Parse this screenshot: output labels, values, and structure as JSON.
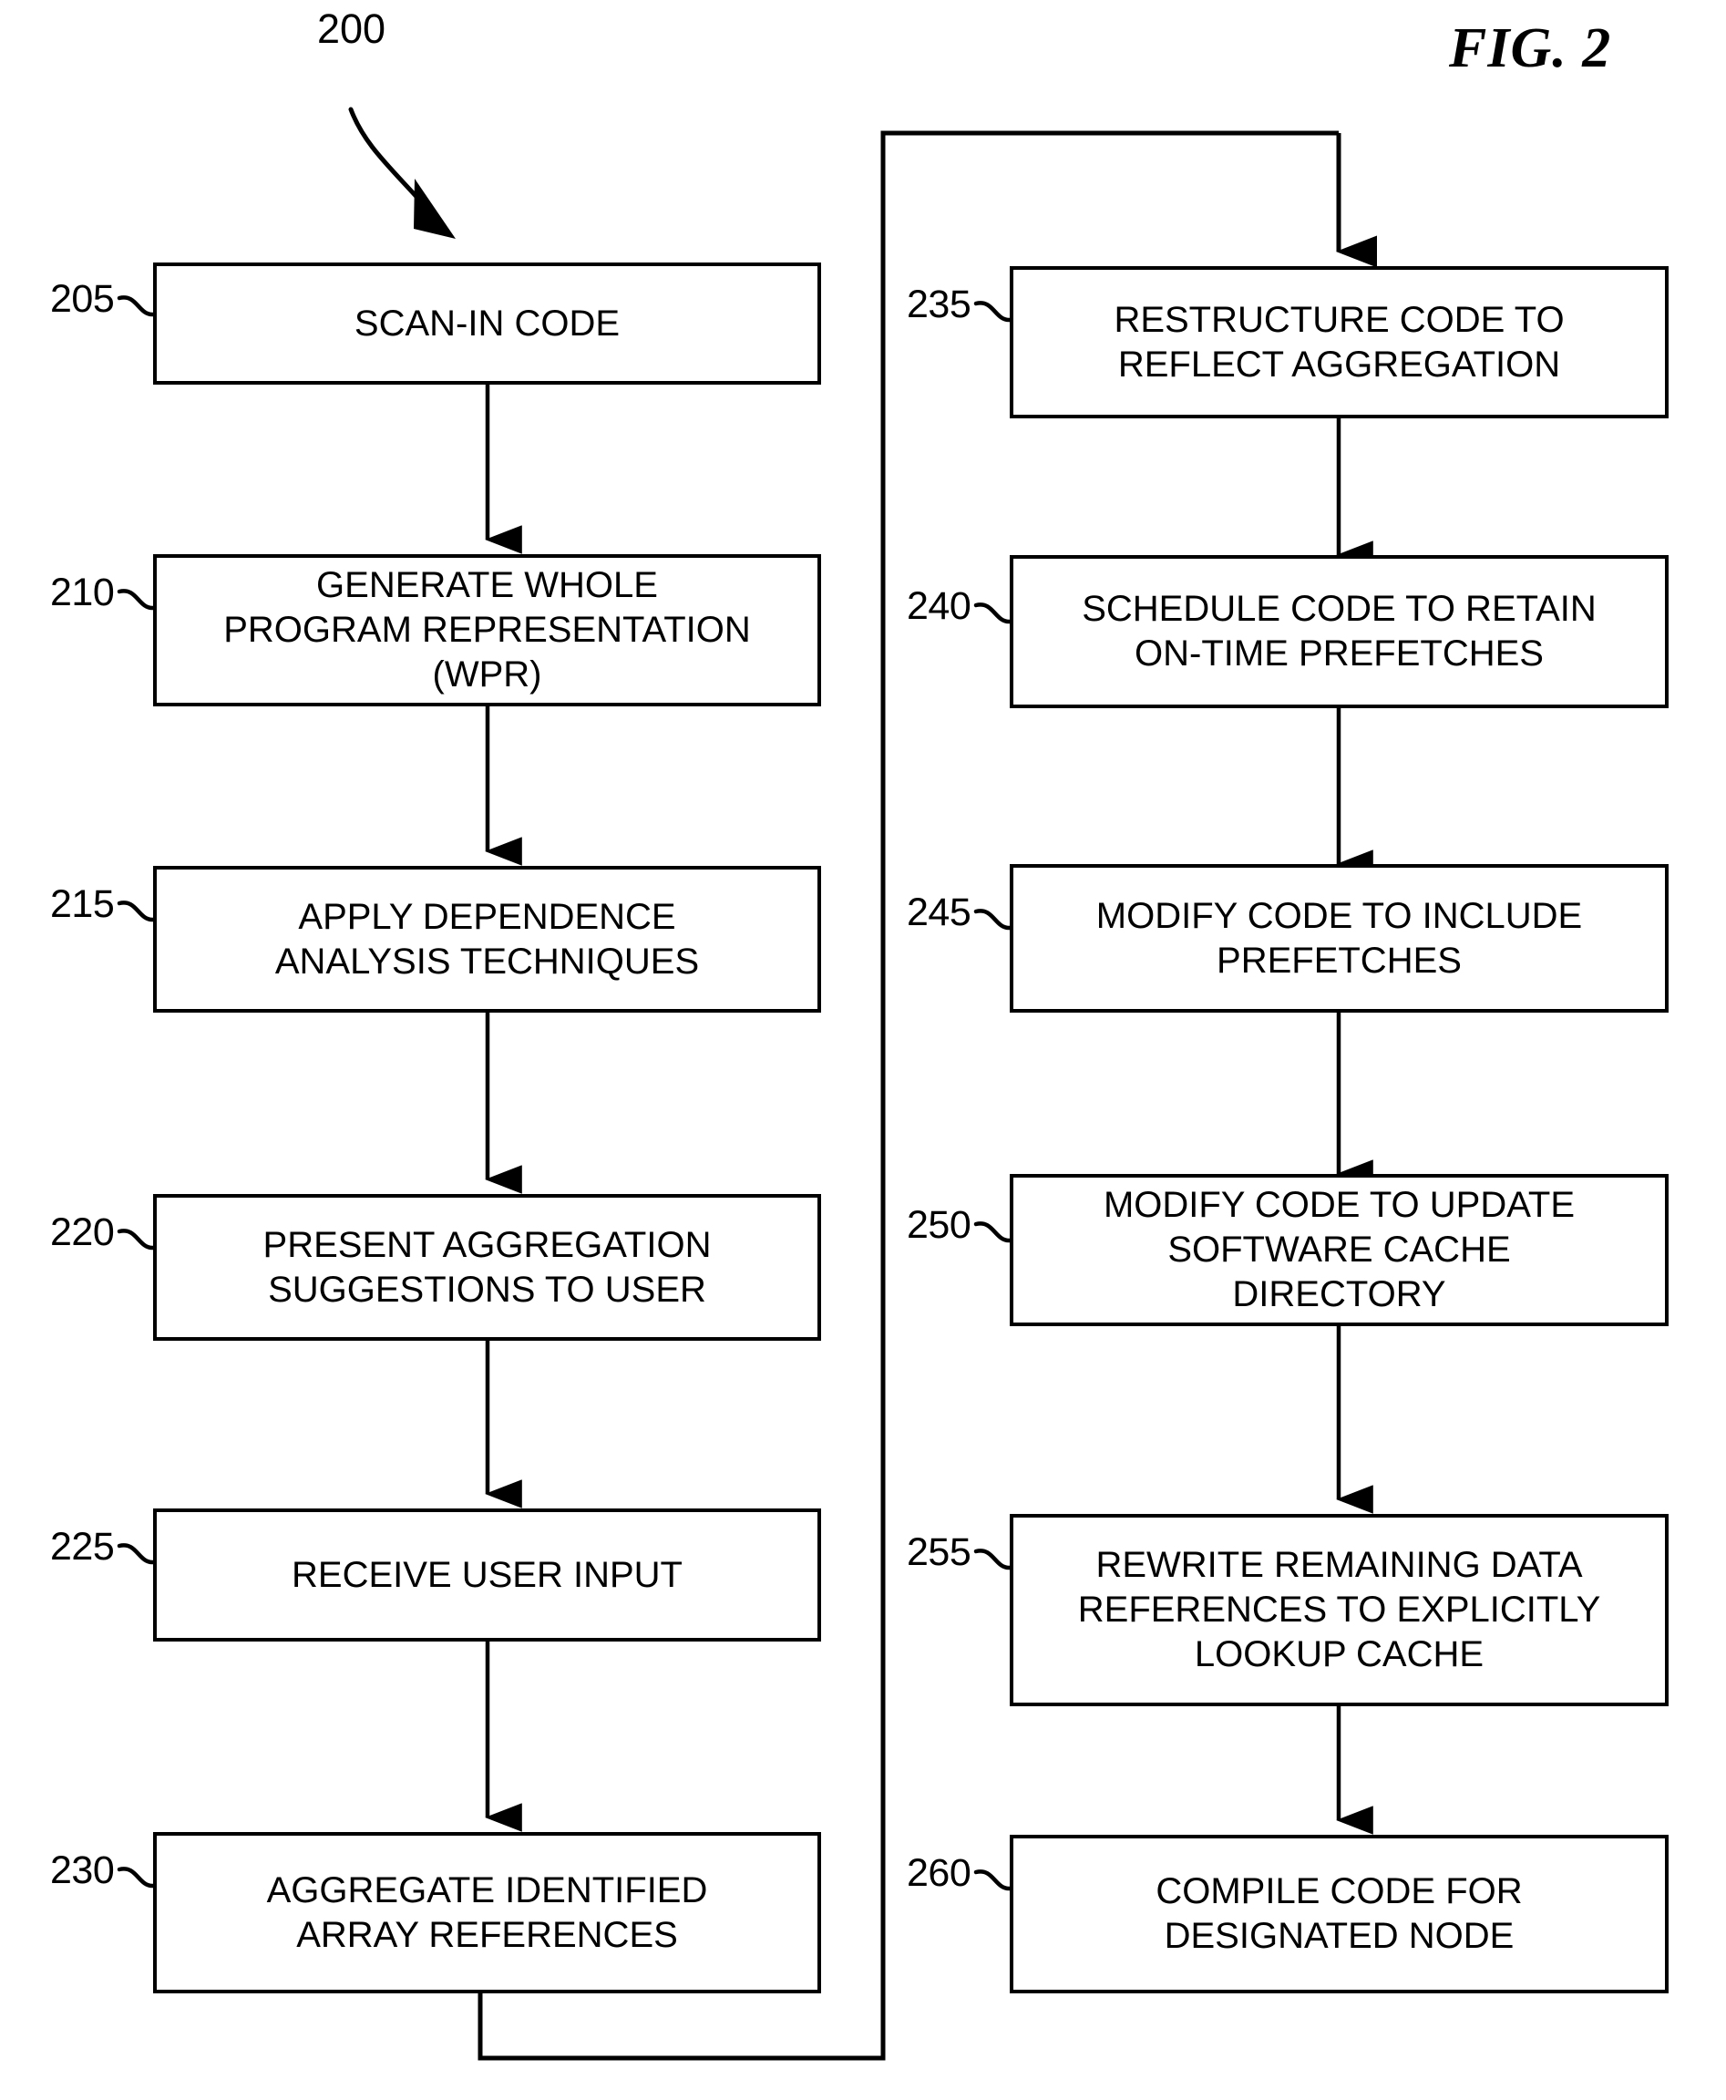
{
  "figure": {
    "title": "FIG. 2",
    "diagram_number": "200"
  },
  "nodes": [
    {
      "ref": "205",
      "label": "SCAN-IN CODE"
    },
    {
      "ref": "210",
      "label": "GENERATE WHOLE\nPROGRAM REPRESENTATION\n(WPR)"
    },
    {
      "ref": "215",
      "label": "APPLY DEPENDENCE\nANALYSIS TECHNIQUES"
    },
    {
      "ref": "220",
      "label": "PRESENT AGGREGATION\nSUGGESTIONS TO USER"
    },
    {
      "ref": "225",
      "label": "RECEIVE USER INPUT"
    },
    {
      "ref": "230",
      "label": "AGGREGATE IDENTIFIED\nARRAY REFERENCES"
    },
    {
      "ref": "235",
      "label": "RESTRUCTURE CODE TO\nREFLECT AGGREGATION"
    },
    {
      "ref": "240",
      "label": "SCHEDULE CODE TO RETAIN\nON-TIME PREFETCHES"
    },
    {
      "ref": "245",
      "label": "MODIFY CODE TO INCLUDE\nPREFETCHES"
    },
    {
      "ref": "250",
      "label": "MODIFY CODE TO UPDATE\nSOFTWARE CACHE\nDIRECTORY"
    },
    {
      "ref": "255",
      "label": "REWRITE REMAINING DATA\nREFERENCES TO EXPLICITLY\nLOOKUP CACHE"
    },
    {
      "ref": "260",
      "label": "COMPILE CODE FOR\nDESIGNATED NODE"
    }
  ],
  "colors": {
    "stroke": "#000000",
    "background": "#ffffff"
  }
}
